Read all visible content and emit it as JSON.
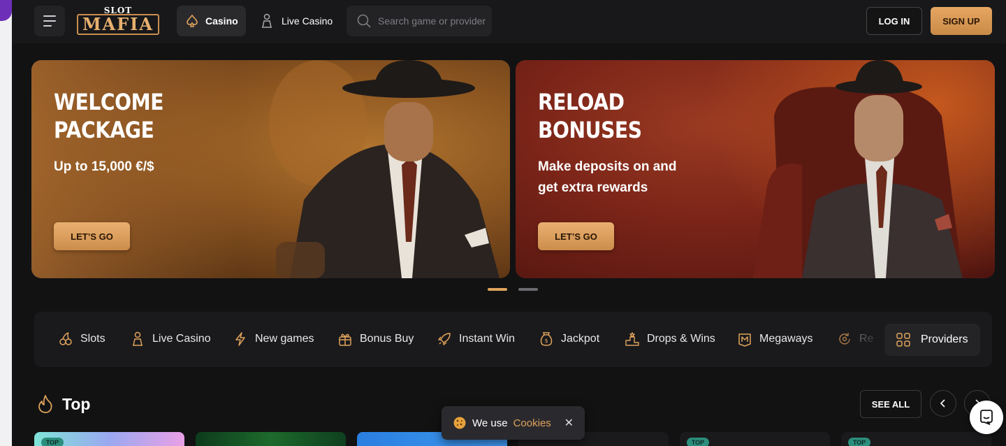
{
  "header": {
    "logo_small": "SLOT",
    "logo_big": "MAFIA",
    "nav": [
      {
        "label": "Casino",
        "icon": "spade-icon",
        "active": true
      },
      {
        "label": "Live Casino",
        "icon": "dealer-icon",
        "active": false
      }
    ],
    "search_placeholder": "Search game or provider",
    "login_label": "LOG IN",
    "signup_label": "SIGN UP"
  },
  "banners": [
    {
      "title_line1": "WELCOME",
      "title_line2": "PACKAGE",
      "subtitle": "Up to 15,000 €/$",
      "button": "LET’S GO"
    },
    {
      "title_line1": "RELOAD",
      "title_line2": "BONUSES",
      "subtitle": "Make deposits on and get extra rewards",
      "button": "LET’S GO"
    }
  ],
  "carousel": {
    "active_index": 0,
    "count": 2
  },
  "categories": [
    {
      "label": "Slots",
      "icon": "cherries-icon"
    },
    {
      "label": "Live Casino",
      "icon": "dealer-icon"
    },
    {
      "label": "New games",
      "icon": "lightning-icon"
    },
    {
      "label": "Bonus Buy",
      "icon": "gift-icon"
    },
    {
      "label": "Instant Win",
      "icon": "rocket-icon"
    },
    {
      "label": "Jackpot",
      "icon": "money-bag-icon"
    },
    {
      "label": "Drops & Wins",
      "icon": "podium-icon"
    },
    {
      "label": "Megaways",
      "icon": "m-badge-icon"
    },
    {
      "label": "Re",
      "icon": "refresh-icon"
    }
  ],
  "providers_label": "Providers",
  "top_section": {
    "title": "Top",
    "see_all": "SEE ALL",
    "badge": "TOP"
  },
  "cookie": {
    "text": "We use",
    "link": "Cookies"
  },
  "colors": {
    "accent": "#e0a35c",
    "background": "#121213",
    "header": "#18181a",
    "badge": "#2b8f7d"
  }
}
